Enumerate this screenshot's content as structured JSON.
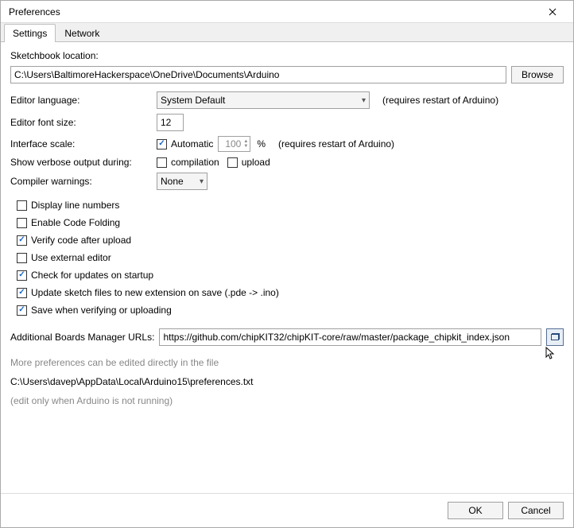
{
  "window": {
    "title": "Preferences"
  },
  "tabs": {
    "settings": "Settings",
    "network": "Network"
  },
  "sketchbook": {
    "label": "Sketchbook location:",
    "value": "C:\\Users\\BaltimoreHackerspace\\OneDrive\\Documents\\Arduino",
    "browse": "Browse"
  },
  "language": {
    "label": "Editor language:",
    "value": "System Default",
    "hint": "(requires restart of Arduino)"
  },
  "fontsize": {
    "label": "Editor font size:",
    "value": "12"
  },
  "scale": {
    "label": "Interface scale:",
    "automatic": "Automatic",
    "value": "100",
    "percent": "%",
    "hint": "(requires restart of Arduino)"
  },
  "verbose": {
    "label": "Show verbose output during:",
    "compilation": "compilation",
    "upload": "upload"
  },
  "warnings": {
    "label": "Compiler warnings:",
    "value": "None"
  },
  "options": {
    "line_numbers": "Display line numbers",
    "code_folding": "Enable Code Folding",
    "verify_upload": "Verify code after upload",
    "external_editor": "Use external editor",
    "check_updates": "Check for updates on startup",
    "update_ext": "Update sketch files to new extension on save (.pde -> .ino)",
    "save_verify": "Save when verifying or uploading"
  },
  "boards": {
    "label": "Additional Boards Manager URLs:",
    "value": "https://github.com/chipKIT32/chipKIT-core/raw/master/package_chipkit_index.json"
  },
  "footer": {
    "note": "More preferences can be edited directly in the file",
    "path": "C:\\Users\\davep\\AppData\\Local\\Arduino15\\preferences.txt",
    "line": "(edit only when Arduino is not running)"
  },
  "buttons": {
    "ok": "OK",
    "cancel": "Cancel"
  },
  "checks": {
    "automatic": true,
    "compilation": false,
    "upload": false,
    "line_numbers": false,
    "code_folding": false,
    "verify_upload": true,
    "external_editor": false,
    "check_updates": true,
    "update_ext": true,
    "save_verify": true
  }
}
